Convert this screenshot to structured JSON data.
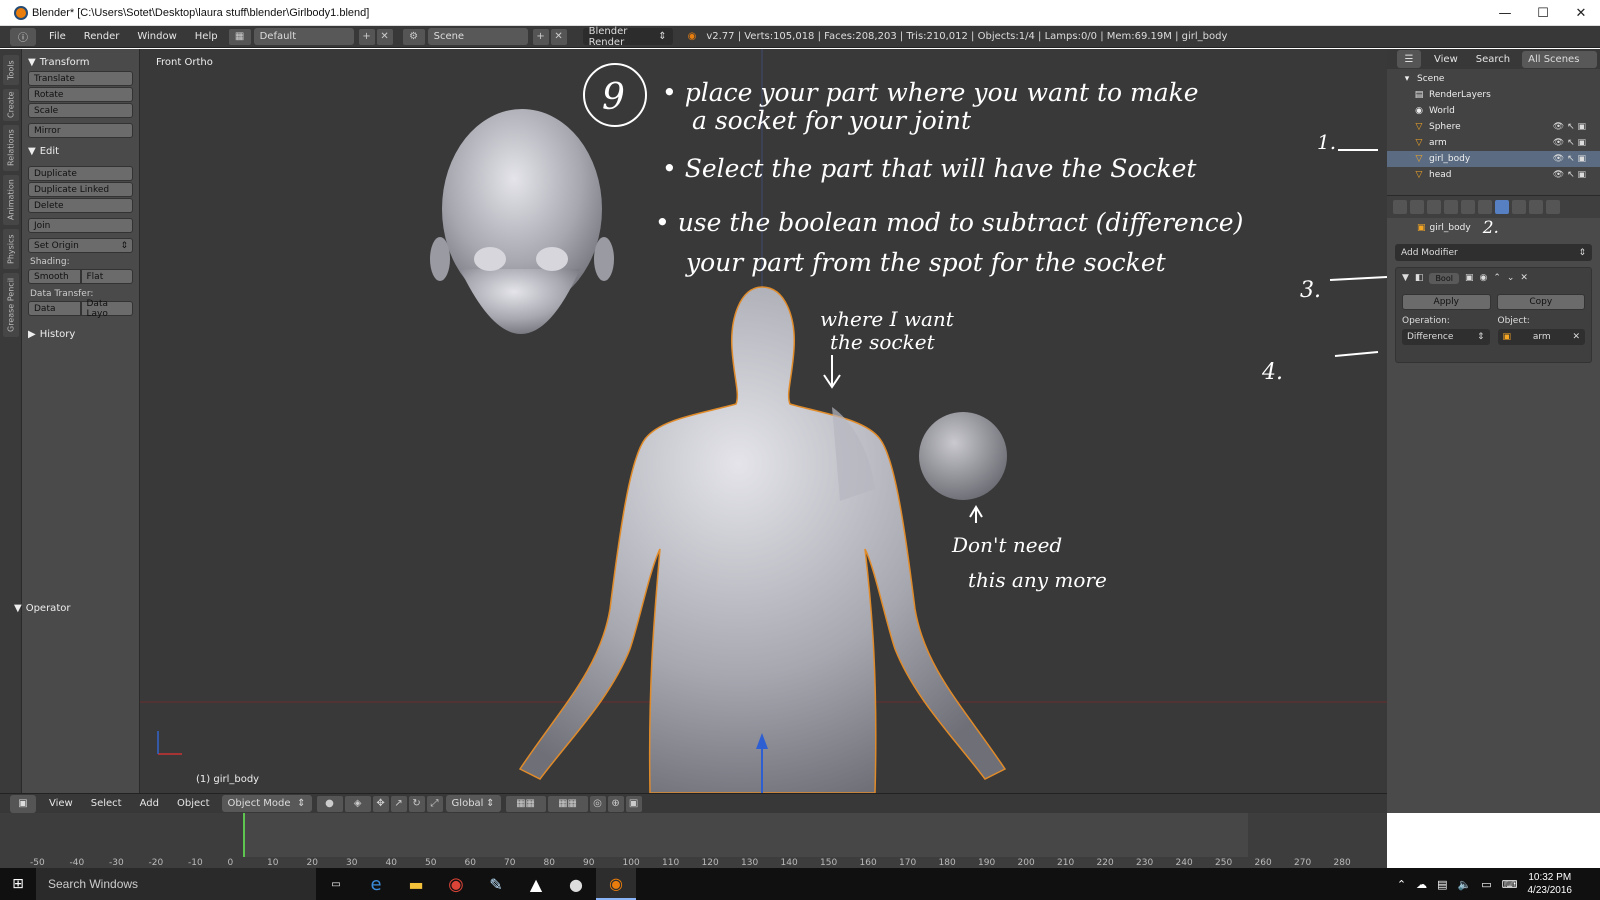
{
  "window": {
    "title": "Blender* [C:\\Users\\Sotet\\Desktop\\laura stuff\\blender\\Girlbody1.blend]",
    "minimize": "—",
    "maximize": "☐",
    "close": "✕"
  },
  "info_header": {
    "menus": [
      "File",
      "Render",
      "Window",
      "Help"
    ],
    "screen_layout": "Default",
    "scene": "Scene",
    "engine": "Blender Render",
    "stats": "v2.77 | Verts:105,018 | Faces:208,203 | Tris:210,012 | Objects:1/4 | Lamps:0/0 | Mem:69.19M | girl_body"
  },
  "tabs": [
    "Tools",
    "Create",
    "Relations",
    "Animation",
    "Physics",
    "Grease Pencil"
  ],
  "toolshelf": {
    "transform_title": "Transform",
    "transform_buttons": [
      "Translate",
      "Rotate",
      "Scale"
    ],
    "mirror": "Mirror",
    "edit_title": "Edit",
    "edit_buttons": [
      "Duplicate",
      "Duplicate Linked",
      "Delete"
    ],
    "join": "Join",
    "set_origin": "Set Origin",
    "shading_label": "Shading:",
    "smooth": "Smooth",
    "flat": "Flat",
    "data_transfer_label": "Data Transfer:",
    "data": "Data",
    "data_layout": "Data Layo",
    "history": "History",
    "operator": "Operator"
  },
  "viewport": {
    "view_label": "Front Ortho",
    "object_label": "(1) girl_body"
  },
  "annotations": {
    "step": "9",
    "line1": "• place your part where you want to make",
    "line2": "a socket for your joint",
    "line3": "• Select the part that will have the Socket",
    "line4": "• use the boolean mod to subtract (difference)",
    "line5": "your part from the spot for the socket",
    "want1": "where I want",
    "want2": "the socket",
    "dont1": "Don't need",
    "dont2": "this any more",
    "n1": "1.",
    "n2": "2.",
    "n3": "3.",
    "n4": "4."
  },
  "viewport_header": {
    "menus": [
      "View",
      "Select",
      "Add",
      "Object"
    ],
    "mode": "Object Mode",
    "orientation": "Global"
  },
  "timeline": {
    "ticks": [
      "-50",
      "-40",
      "-30",
      "-20",
      "-10",
      "0",
      "10",
      "20",
      "30",
      "40",
      "50",
      "60",
      "70",
      "80",
      "90",
      "100",
      "110",
      "120",
      "130",
      "140",
      "150",
      "160",
      "170",
      "180",
      "190",
      "200",
      "210",
      "220",
      "230",
      "240",
      "250",
      "260",
      "270",
      "280"
    ]
  },
  "outliner": {
    "menus": [
      "View",
      "Search"
    ],
    "filter": "All Scenes",
    "items": [
      {
        "name": "Scene",
        "icon": "▾"
      },
      {
        "name": "RenderLayers",
        "icon": "▤"
      },
      {
        "name": "World",
        "icon": "◉"
      },
      {
        "name": "Sphere",
        "icon": "▽"
      },
      {
        "name": "arm",
        "icon": "▽"
      },
      {
        "name": "girl_body",
        "icon": "▽"
      },
      {
        "name": "head",
        "icon": "▽"
      }
    ]
  },
  "properties": {
    "context_object": "girl_body",
    "add_modifier": "Add Modifier",
    "modifier_name": "Bool",
    "apply": "Apply",
    "copy": "Copy",
    "operation_label": "Operation:",
    "operation_value": "Difference",
    "object_label": "Object:",
    "object_value": "arm"
  },
  "taskbar": {
    "search": "Search Windows",
    "time": "10:32 PM",
    "date": "4/23/2016"
  }
}
